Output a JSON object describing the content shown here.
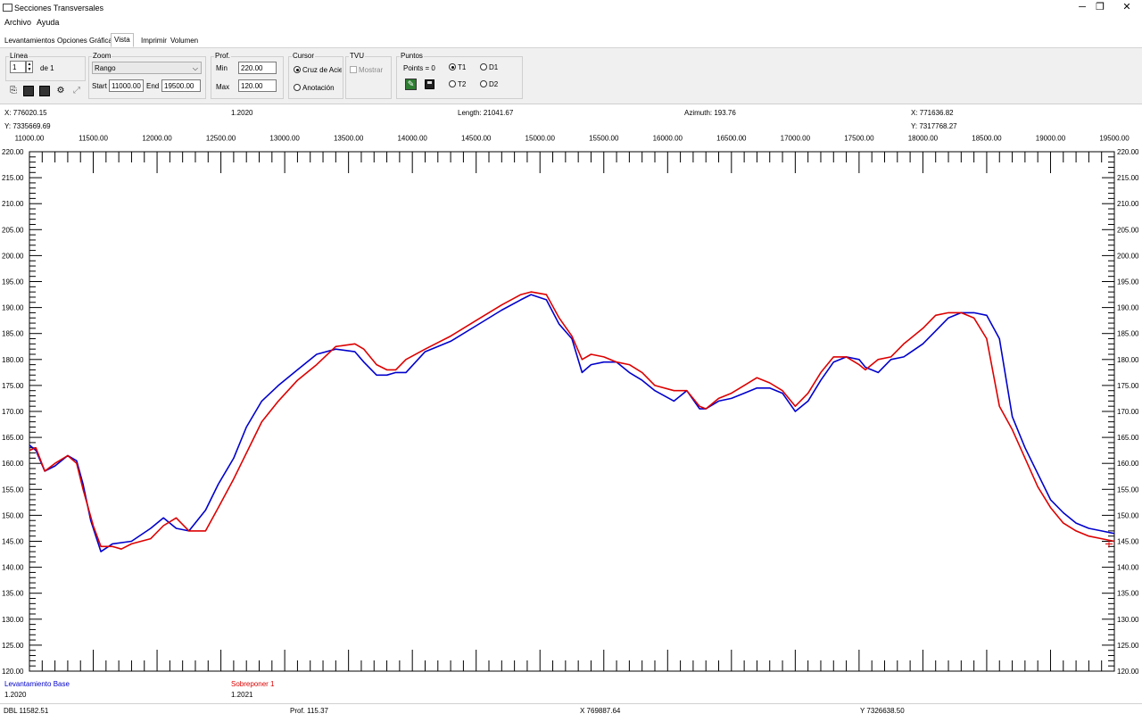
{
  "window": {
    "title": "Secciones Transversales",
    "controls": [
      "─",
      "❐",
      "✕"
    ]
  },
  "menu": [
    "Archivo",
    "Ayuda"
  ],
  "tabs": [
    "Levantamientos",
    "Opciones Gráficas",
    "Vista",
    "Imprimir",
    "Volumen"
  ],
  "active_tab": "Vista",
  "toolbar": {
    "linea": {
      "label": "Línea",
      "value": "1",
      "of_text": "de 1"
    },
    "zoom": {
      "label": "Zoom",
      "mode": "Rango",
      "start_label": "Start",
      "start_value": "11000.00",
      "end_label": "End",
      "end_value": "19500.00"
    },
    "prof": {
      "label": "Prof.",
      "min_label": "Min",
      "min_value": "220.00",
      "max_label": "Max",
      "max_value": "120.00"
    },
    "cursor": {
      "label": "Cursor",
      "option1": "Cruz de Acierto",
      "option2": "Anotación",
      "selected": "Cruz de Acierto"
    },
    "tvu": {
      "label": "TVU",
      "check_label": "Mostrar",
      "checked": false
    },
    "puntos": {
      "label": "Puntos",
      "points_text": "Points = 0",
      "t1": "T1",
      "t2": "T2",
      "d1": "D1",
      "d2": "D2",
      "selected": "T1"
    }
  },
  "info": {
    "x_left": "X: 776020.15",
    "y_left": "Y: 7335669.69",
    "version": "1.2020",
    "length": "Length: 21041.67",
    "azimuth": "Azimuth: 193.76",
    "x_right": "X: 771636.82",
    "y_right": "Y: 7317768.27"
  },
  "chart_data": {
    "type": "line",
    "x_ticks": [
      "11000.00",
      "11500.00",
      "12000.00",
      "12500.00",
      "13000.00",
      "13500.00",
      "14000.00",
      "14500.00",
      "15000.00",
      "15500.00",
      "16000.00",
      "16500.00",
      "17000.00",
      "17500.00",
      "18000.00",
      "18500.00",
      "19000.00",
      "19500.00"
    ],
    "y_ticks": [
      "220.00",
      "215.00",
      "210.00",
      "205.00",
      "200.00",
      "195.00",
      "190.00",
      "185.00",
      "180.00",
      "175.00",
      "170.00",
      "165.00",
      "160.00",
      "155.00",
      "150.00",
      "145.00",
      "140.00",
      "135.00",
      "130.00",
      "125.00",
      "120.00"
    ],
    "xlim": [
      11000,
      19500
    ],
    "ylim": [
      120,
      220
    ],
    "series": [
      {
        "name": "Levantamiento Base",
        "color": "#0000cc",
        "x": [
          11000,
          11050,
          11120,
          11200,
          11300,
          11370,
          11420,
          11480,
          11560,
          11650,
          11800,
          11950,
          12050,
          12150,
          12250,
          12380,
          12480,
          12600,
          12700,
          12820,
          12950,
          13100,
          13250,
          13400,
          13550,
          13620,
          13720,
          13800,
          13870,
          13950,
          14100,
          14300,
          14500,
          14700,
          14850,
          14930,
          15050,
          15150,
          15250,
          15330,
          15400,
          15500,
          15600,
          15700,
          15800,
          15900,
          16050,
          16150,
          16250,
          16300,
          16400,
          16500,
          16600,
          16700,
          16800,
          16900,
          17000,
          17100,
          17200,
          17300,
          17400,
          17500,
          17550,
          17650,
          17750,
          17850,
          18000,
          18100,
          18200,
          18300,
          18400,
          18500,
          18600,
          18700,
          18800,
          18900,
          19000,
          19100,
          19200,
          19300,
          19400,
          19500
        ],
        "y": [
          163.5,
          162.5,
          158.5,
          159.5,
          161.5,
          160.5,
          156,
          149,
          143,
          144.5,
          145,
          147.5,
          149.5,
          147.5,
          147,
          151,
          156,
          161,
          167,
          172,
          175,
          178,
          181,
          182,
          181.5,
          179.5,
          177,
          177,
          177.5,
          177.5,
          181.5,
          183.5,
          186.5,
          189.5,
          191.5,
          192.5,
          191.5,
          186.8,
          184,
          177.5,
          179,
          179.5,
          179.5,
          177.5,
          176,
          174,
          172,
          174,
          170.5,
          170.5,
          172,
          172.5,
          173.5,
          174.5,
          174.5,
          173.5,
          170,
          172,
          176,
          179.5,
          180.5,
          180,
          178.5,
          177.5,
          180,
          180.5,
          183,
          185.5,
          188,
          189,
          189,
          188.5,
          184,
          169,
          163,
          158,
          153,
          150.5,
          148.5,
          147.5,
          147,
          146.5
        ]
      },
      {
        "name": "Sobreponer 1",
        "color": "#dd0000",
        "x": [
          11000,
          11050,
          11120,
          11200,
          11300,
          11370,
          11420,
          11500,
          11560,
          11650,
          11720,
          11800,
          11950,
          12050,
          12150,
          12250,
          12380,
          12480,
          12600,
          12700,
          12820,
          12950,
          13100,
          13250,
          13400,
          13550,
          13620,
          13720,
          13800,
          13870,
          13950,
          14100,
          14300,
          14500,
          14700,
          14850,
          14930,
          15050,
          15150,
          15250,
          15330,
          15400,
          15500,
          15600,
          15700,
          15800,
          15900,
          16050,
          16150,
          16250,
          16300,
          16400,
          16500,
          16600,
          16700,
          16800,
          16900,
          17000,
          17100,
          17200,
          17300,
          17400,
          17500,
          17550,
          17650,
          17750,
          17850,
          18000,
          18100,
          18200,
          18300,
          18400,
          18500,
          18600,
          18700,
          18800,
          18900,
          19000,
          19100,
          19200,
          19300,
          19400,
          19500
        ],
        "y": [
          162.5,
          163,
          158.5,
          160,
          161.5,
          160,
          155,
          148,
          144,
          144,
          143.5,
          144.5,
          145.5,
          148,
          149.5,
          147,
          147,
          151.5,
          157,
          162,
          168,
          172,
          176,
          179,
          182.5,
          183,
          182,
          179,
          178,
          178,
          180,
          182,
          184.5,
          187.5,
          190.5,
          192.5,
          193,
          192.5,
          188,
          184.5,
          180,
          181,
          180.5,
          179.5,
          179,
          177.5,
          175,
          174,
          174,
          171,
          170.5,
          172.5,
          173.5,
          175,
          176.5,
          175.5,
          174,
          171,
          173.5,
          177.5,
          180.5,
          180.5,
          179,
          178,
          180,
          180.5,
          183,
          186,
          188.5,
          189,
          189,
          188,
          184,
          171,
          166.5,
          161,
          155.5,
          151.5,
          148.5,
          147,
          146,
          145.5,
          145
        ]
      }
    ],
    "legend": [
      {
        "name": "Levantamiento Base",
        "value": "1.2020",
        "color": "#0000cc"
      },
      {
        "name": "Sobreponer 1",
        "value": "1.2021",
        "color": "#dd0000"
      }
    ]
  },
  "status": {
    "dbl": "DBL 11582.51",
    "prof": "Prof. 115.37",
    "x": "X 769887.64",
    "y": "Y 7326638.50"
  }
}
